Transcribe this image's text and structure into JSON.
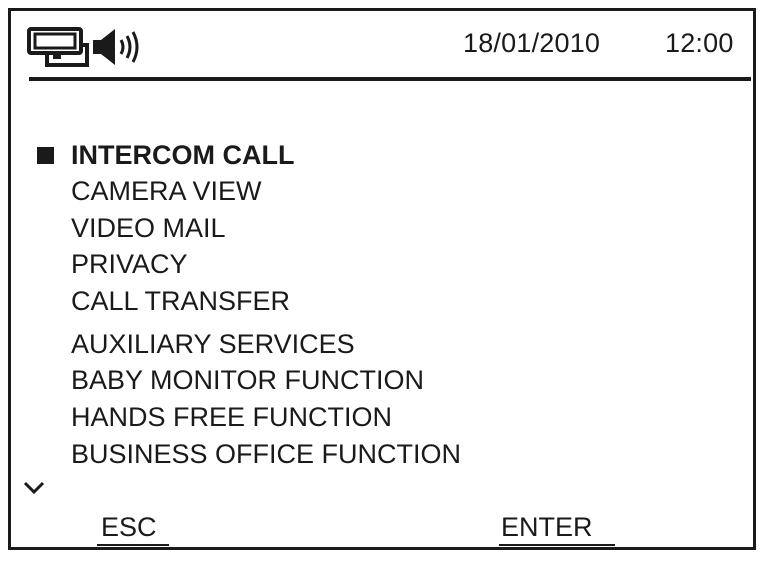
{
  "header": {
    "date": "18/01/2010",
    "time": "12:00",
    "icons": [
      "intercom-icon",
      "speaker-icon"
    ]
  },
  "menu": {
    "selected_index": 0,
    "items": [
      {
        "label": "INTERCOM CALL"
      },
      {
        "label": "CAMERA VIEW"
      },
      {
        "label": "VIDEO MAIL"
      },
      {
        "label": "PRIVACY"
      },
      {
        "label": "CALL TRANSFER"
      },
      {
        "label": "AUXILIARY SERVICES"
      },
      {
        "label": "BABY MONITOR FUNCTION"
      },
      {
        "label": "HANDS FREE FUNCTION"
      },
      {
        "label": "BUSINESS OFFICE FUNCTION"
      }
    ],
    "more_indicator_icon": "chevron-down-icon"
  },
  "softkeys": {
    "left_label": "ESC",
    "right_label": "ENTER"
  },
  "colors": {
    "foreground": "#1a1a1a",
    "background": "#ffffff"
  }
}
